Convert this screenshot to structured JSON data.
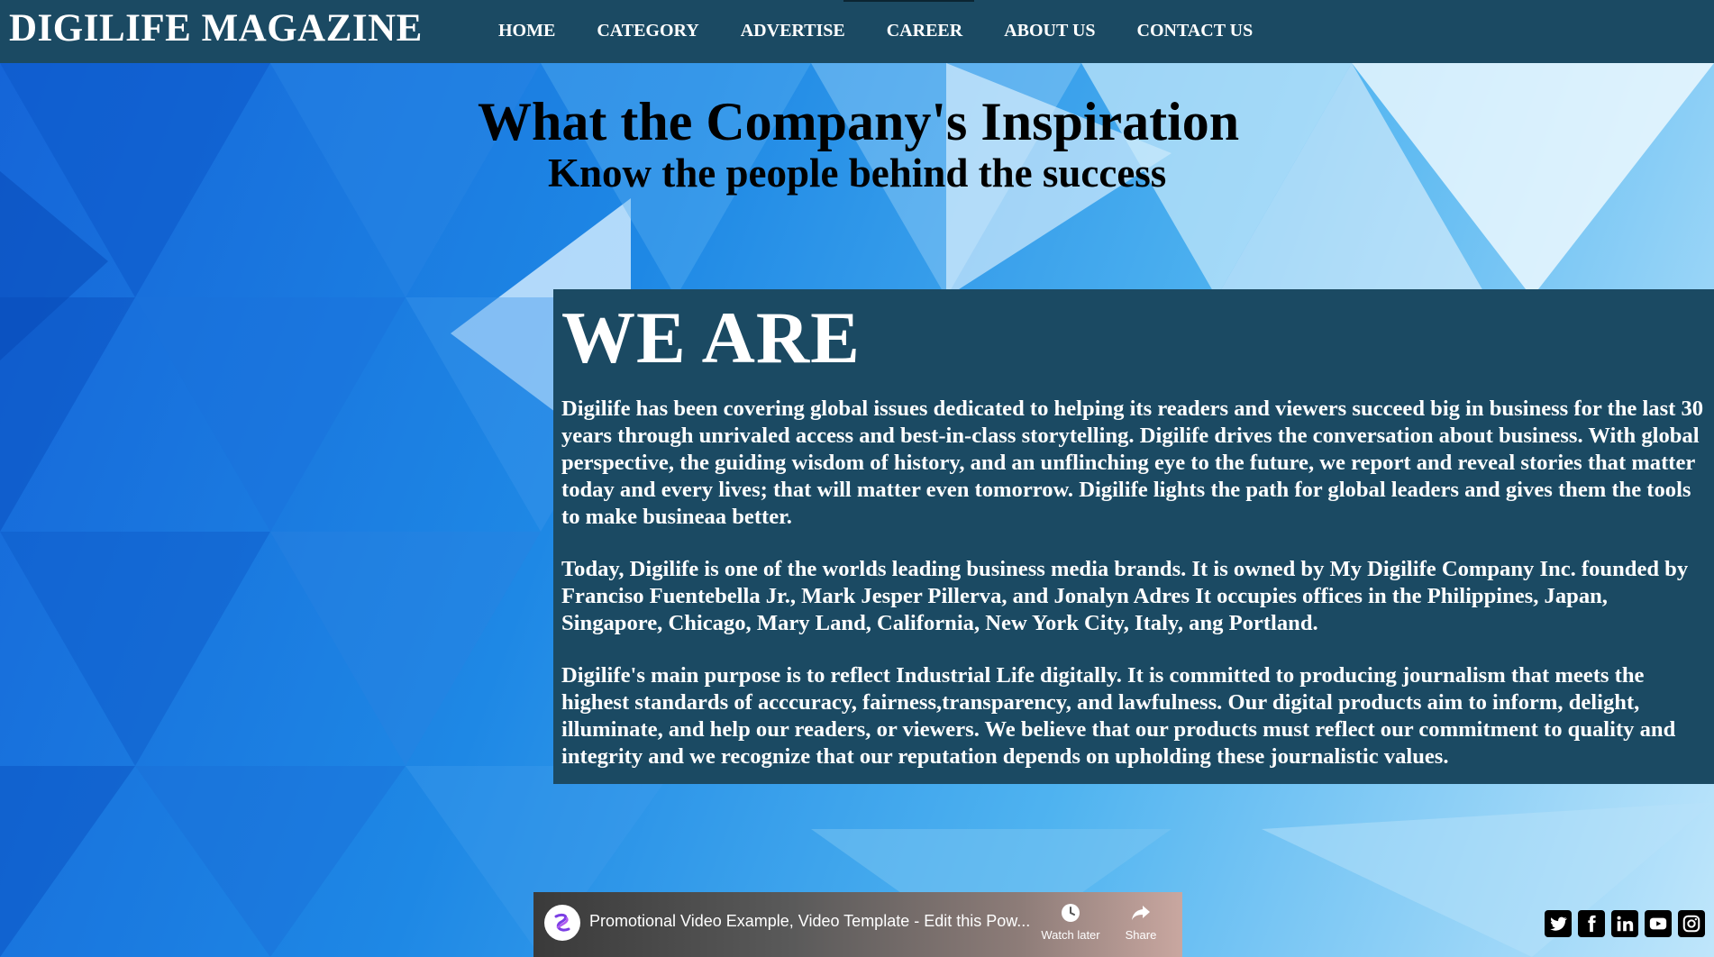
{
  "header": {
    "brand": "DIGILIFE MAGAZINE",
    "nav": [
      "HOME",
      "CATEGORY",
      "ADVERTISE",
      "CAREER",
      "ABOUT US",
      "CONTACT US"
    ]
  },
  "hero": {
    "title": "What the Company's Inspiration",
    "subtitle": "Know the people behind the success"
  },
  "about": {
    "heading": "WE ARE",
    "paragraphs": [
      "Digilife has been covering global issues dedicated to helping its readers and viewers succeed big in business for the last 30 years through unrivaled access and best-in-class storytelling. Digilife drives the conversation about business. With global perspective, the guiding wisdom of history, and an unflinching eye to the future, we report and reveal stories that matter today and every lives; that will matter even tomorrow. Digilife lights the path for global leaders and gives them the tools to make busineaa better.",
      "Today, Digilife is one of the worlds leading business media brands. It is owned by My Digilife Company Inc. founded by Franciso Fuentebella Jr., Mark Jesper Pillerva, and Jonalyn Adres It occupies offices in the Philippines, Japan, Singapore, Chicago, Mary Land, California, New York City, Italy, ang Portland.",
      "Digilife's main purpose is to reflect Industrial Life digitally. It is committed to producing journalism that meets the highest standards of acccuracy, fairness,transparency, and lawfulness. Our digital products aim to inform, delight, illuminate, and help our readers, or viewers. We believe that our products must reflect our commitment to quality and integrity and we recognize that our reputation depends on upholding these journalistic values."
    ]
  },
  "video": {
    "title": "Promotional Video Example, Video Template - Edit this Pow...",
    "watch_later": "Watch later",
    "share": "Share"
  },
  "social": [
    "twitter-icon",
    "facebook-icon",
    "linkedin-icon",
    "youtube-icon",
    "instagram-icon"
  ],
  "colors": {
    "header_bg": "#1b4a63",
    "panel_bg": "#1b4a63",
    "text_light": "#ffffff"
  }
}
